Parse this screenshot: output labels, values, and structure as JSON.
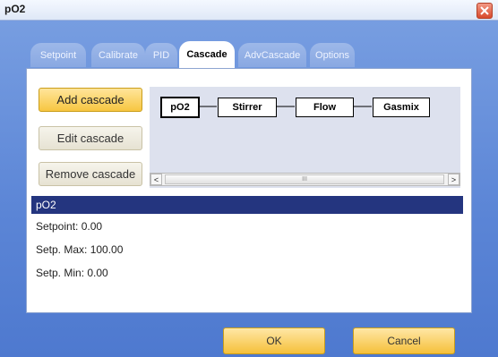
{
  "window": {
    "title": "pO2"
  },
  "tabs": [
    {
      "label": "Setpoint"
    },
    {
      "label": "Calibrate"
    },
    {
      "label": "PID"
    },
    {
      "label": "Cascade"
    },
    {
      "label": "AdvCascade"
    },
    {
      "label": "Options"
    }
  ],
  "active_tab": "Cascade",
  "buttons": {
    "add": "Add cascade",
    "edit": "Edit cascade",
    "remove": "Remove cascade"
  },
  "cascade_nodes": [
    "pO2",
    "Stirrer",
    "Flow",
    "Gasmix"
  ],
  "scrollbar": {
    "left_arrow": "<",
    "right_arrow": ">",
    "thumb_grip": "III"
  },
  "info": {
    "header": "pO2",
    "setpoint": "Setpoint: 0.00",
    "setp_max": "Setp. Max: 100.00",
    "setp_min": "Setp. Min: 0.00"
  },
  "footer": {
    "ok": "OK",
    "cancel": "Cancel"
  },
  "colors": {
    "accent": "#f7c641",
    "selection": "#24357f",
    "background": "#5b85d6"
  },
  "icons": {
    "close": "close-icon"
  }
}
